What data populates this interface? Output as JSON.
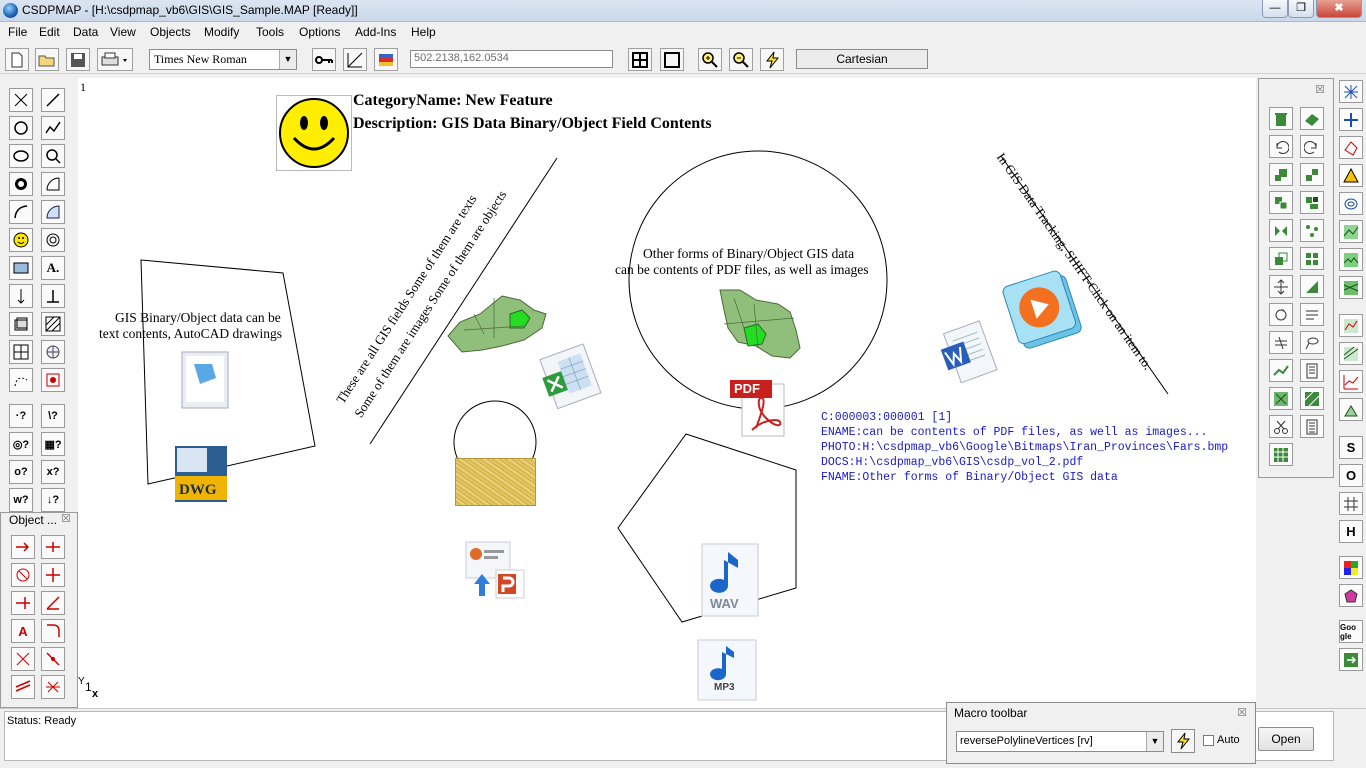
{
  "window": {
    "title": "CSDPMAP - [H:\\csdpmap_vb6\\GIS\\GIS_Sample.MAP [Ready]]",
    "min": "—",
    "max": "❒",
    "close": "✖"
  },
  "menu": [
    "File",
    "Edit",
    "Data",
    "View",
    "Objects",
    "Modify",
    "Tools",
    "Options",
    "Add-Ins",
    "Help"
  ],
  "toolbar": {
    "font": "Times New Roman",
    "coords": "502.2138,162.0534",
    "mode": "Cartesian"
  },
  "canvas": {
    "page_number": "1",
    "heading1": "CategoryName: New Feature",
    "heading2": "Description: GIS Data Binary/Object Field Contents",
    "left_text1": "GIS Binary/Object data can be",
    "left_text2": "text contents, AutoCAD drawings",
    "diag_text1": "These are all GIS fields  Some of them are texts",
    "diag_text2": "Some of them are images  Some of them are objects",
    "circle_text1": "Other forms of Binary/Object GIS data",
    "circle_text2": "can be contents of PDF files, as well as images",
    "right_diag_text": "In GIS Data Tracking, SHIFT-Click on an item to.",
    "dwg_label": "DWG",
    "pdf_label": "PDF",
    "wav_label": "WAV",
    "mp3_label": "MP3",
    "info": [
      "C:000003:000001 [1]",
      "ENAME:can be contents of PDF files, as well as images...",
      "PHOTO:H:\\csdpmap_vb6\\Google\\Bitmaps\\Iran_Provinces\\Fars.bmp",
      "DOCS:H:\\csdpmap_vb6\\GIS\\csdp_vol_2.pdf",
      "FNAME:Other forms of Binary/Object GIS data"
    ],
    "axis_y": "Y",
    "axis_origin": "1",
    "axis_x": "x"
  },
  "object_panel": {
    "title": "Object ...",
    "close": "☒"
  },
  "right_panel": {
    "close": "☒"
  },
  "status": {
    "text": "Status: Ready"
  },
  "macro": {
    "title": "Macro toolbar",
    "close": "☒",
    "select": "reversePolylineVertices [rv]",
    "auto_label": "Auto",
    "open_label": "Open"
  },
  "colors": {
    "info_text": "#1a1acc",
    "map_fill": "#8fbf7a",
    "map_highlight": "#22dd22",
    "pdf_red": "#c8201e"
  }
}
